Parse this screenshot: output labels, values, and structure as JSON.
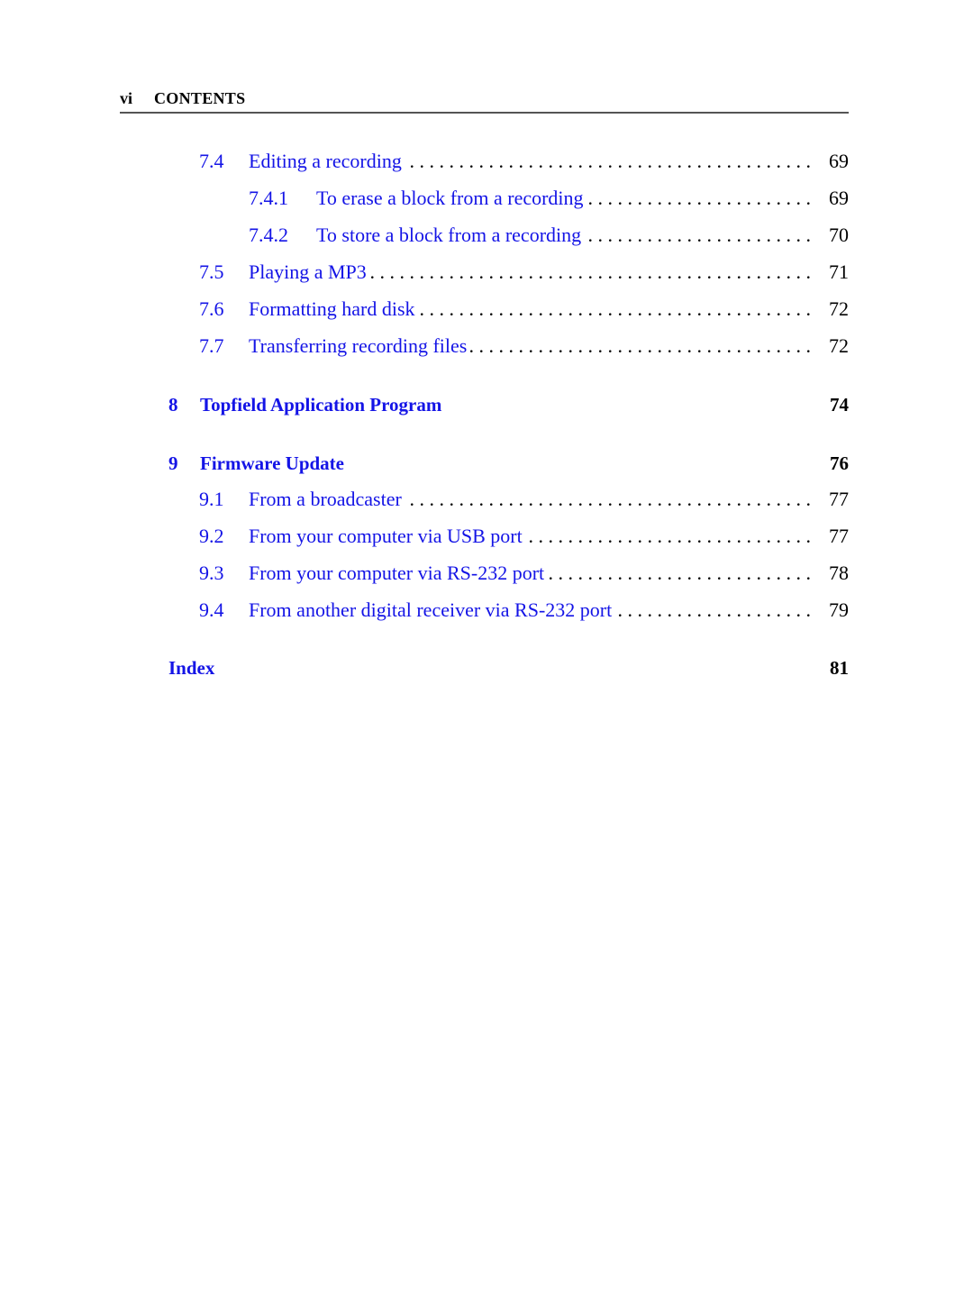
{
  "header": {
    "page_number": "vi",
    "title": "CONTENTS"
  },
  "colors": {
    "link": "#1414e6",
    "text": "#000000",
    "rule": "#555555"
  },
  "toc": [
    {
      "level": "section",
      "number": "7.4",
      "title": "Editing a recording",
      "page": "69"
    },
    {
      "level": "subsection",
      "number": "7.4.1",
      "title": "To erase a block from a recording",
      "page": "69"
    },
    {
      "level": "subsection",
      "number": "7.4.2",
      "title": "To store a block from a recording",
      "page": "70"
    },
    {
      "level": "section",
      "number": "7.5",
      "title": "Playing a MP3",
      "page": "71"
    },
    {
      "level": "section",
      "number": "7.6",
      "title": "Formatting hard disk",
      "page": "72"
    },
    {
      "level": "section",
      "number": "7.7",
      "title": "Transferring recording files",
      "page": "72"
    },
    {
      "level": "chapter",
      "number": "8",
      "title": "Topfield Application Program",
      "page": "74"
    },
    {
      "level": "chapter",
      "number": "9",
      "title": "Firmware Update",
      "page": "76"
    },
    {
      "level": "section",
      "number": "9.1",
      "title": "From a broadcaster",
      "page": "77"
    },
    {
      "level": "section",
      "number": "9.2",
      "title": "From your computer via USB port",
      "page": "77"
    },
    {
      "level": "section",
      "number": "9.3",
      "title": "From your computer via RS-232 port",
      "page": "78"
    },
    {
      "level": "section",
      "number": "9.4",
      "title": "From another digital receiver via RS-232 port",
      "page": "79"
    },
    {
      "level": "chapter",
      "number": "",
      "title": "Index",
      "page": "81"
    }
  ],
  "leader": ". . . . . . . . . . . . . . . . . . . . . . . . . . . . . . . . . . . . . . . . . . . . . . . ."
}
